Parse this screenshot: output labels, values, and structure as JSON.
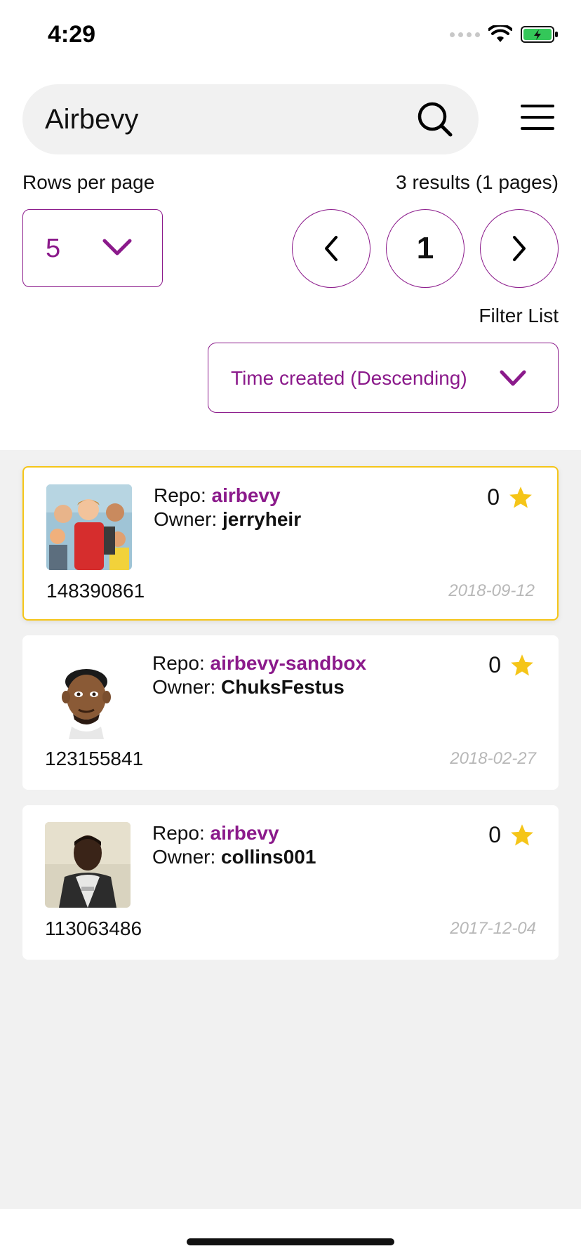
{
  "status_bar": {
    "time": "4:29"
  },
  "search": {
    "value": "Airbevy"
  },
  "pagination": {
    "rows_label": "Rows per page",
    "rows_value": "5",
    "results_text": "3 results (1 pages)",
    "current_page": "1"
  },
  "filter": {
    "label": "Filter List",
    "value": "Time created (Descending)"
  },
  "colors": {
    "accent": "#8b1a8b",
    "star": "#f5c518",
    "selected_border": "#f5c518",
    "list_background": "#f1f1f1"
  },
  "repo_prefix": "Repo: ",
  "owner_prefix": "Owner: ",
  "cards": [
    {
      "repo": "airbevy",
      "owner": "jerryheir",
      "stars": "0",
      "id": "148390861",
      "date": "2018-09-12",
      "selected": true
    },
    {
      "repo": "airbevy-sandbox",
      "owner": "ChuksFestus",
      "stars": "0",
      "id": "123155841",
      "date": "2018-02-27",
      "selected": false
    },
    {
      "repo": "airbevy",
      "owner": "collins001",
      "stars": "0",
      "id": "113063486",
      "date": "2017-12-04",
      "selected": false
    }
  ]
}
